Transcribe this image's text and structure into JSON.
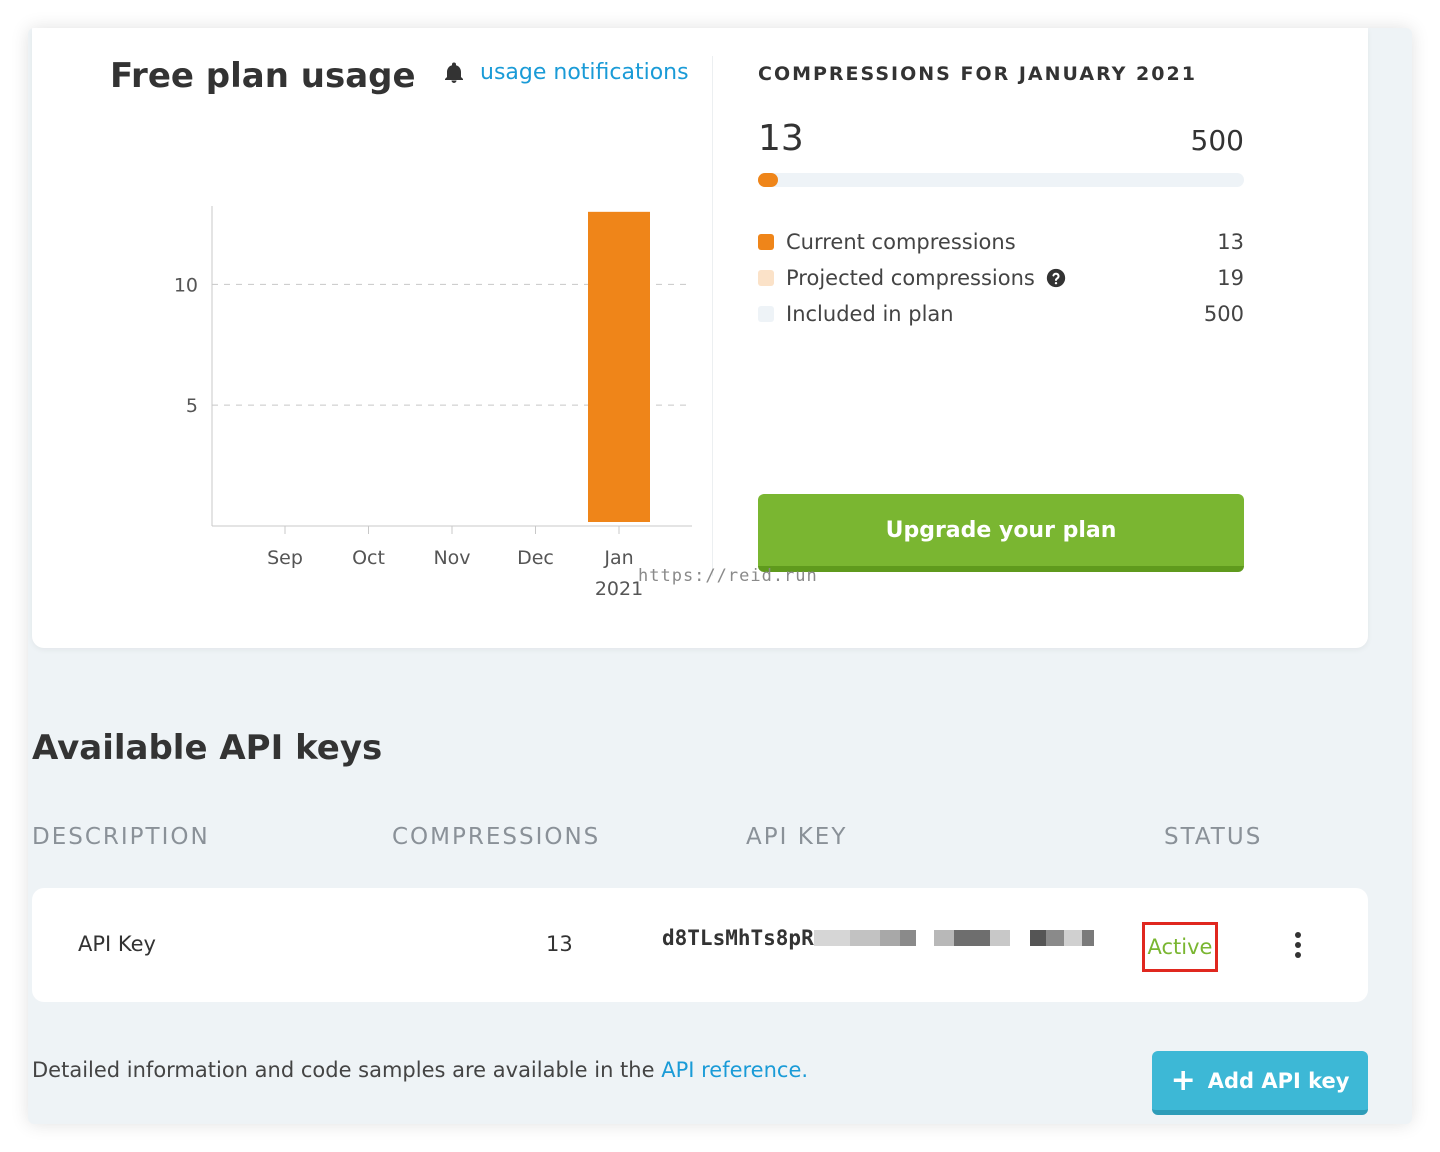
{
  "usage": {
    "title": "Free plan usage",
    "notifications_link": "usage notifications",
    "compressions_heading": "COMPRESSIONS FOR JANUARY 2021",
    "current": "13",
    "limit": "500",
    "progress_fraction": 0.026,
    "legend": [
      {
        "label": "Current compressions",
        "value": "13",
        "color": "#ef8519"
      },
      {
        "label": "Projected compressions",
        "value": "19",
        "color": "#fbe2c8"
      },
      {
        "label": "Included in plan",
        "value": "500",
        "color": "#eef3f7"
      }
    ],
    "upgrade_button": "Upgrade your plan"
  },
  "chart_data": {
    "type": "bar",
    "categories": [
      "Sep",
      "Oct",
      "Nov",
      "Dec",
      "Jan"
    ],
    "category_sublabels": [
      "",
      "",
      "",
      "",
      "2021"
    ],
    "values": [
      0,
      0,
      0,
      0,
      13
    ],
    "bar_color": "#ef8519",
    "yticks": [
      5,
      10
    ],
    "ylim": [
      0,
      14.4
    ],
    "grid": "dashed horizontal"
  },
  "watermark": "https://reid.run",
  "api_keys": {
    "title": "Available API keys",
    "columns": [
      "DESCRIPTION",
      "COMPRESSIONS",
      "API KEY",
      "STATUS"
    ],
    "rows": [
      {
        "description": "API Key",
        "compressions": "13",
        "key_prefix": "d8TLsMhTs8pR",
        "status": "Active"
      }
    ],
    "footer_text": "Detailed information and code samples are available in the ",
    "footer_link": "API reference.",
    "add_button": "Add API key"
  }
}
